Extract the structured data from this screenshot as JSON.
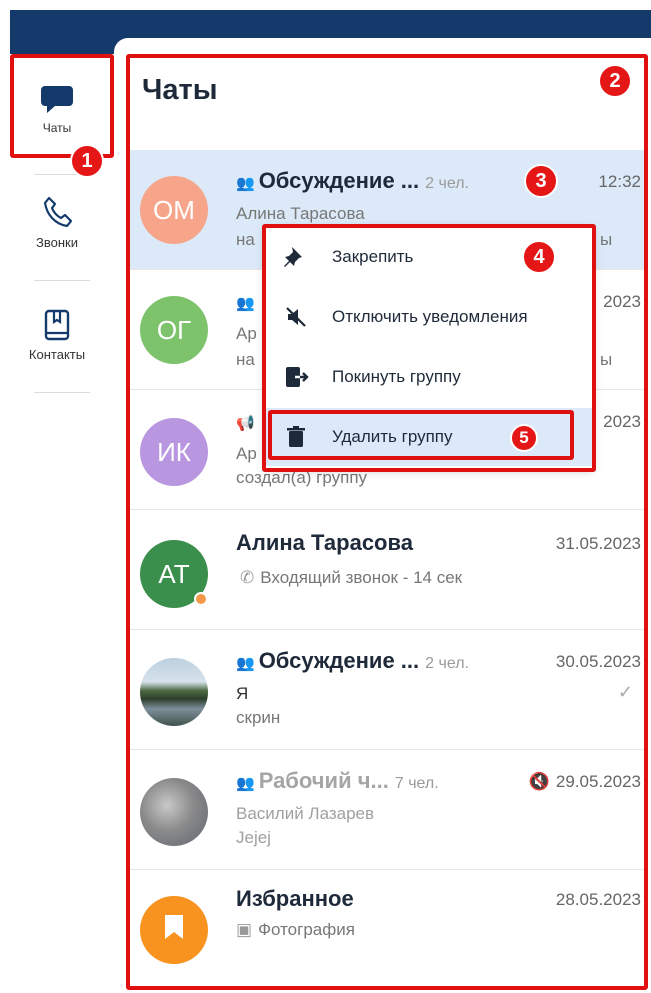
{
  "sidebar": {
    "items": [
      {
        "label": "Чаты",
        "icon": "chat-bubble-icon"
      },
      {
        "label": "Звонки",
        "icon": "phone-icon"
      },
      {
        "label": "Контакты",
        "icon": "contacts-book-icon"
      }
    ]
  },
  "header": {
    "title": "Чаты"
  },
  "chats": [
    {
      "initials": "ОМ",
      "avatar_color": "#f7a58a",
      "name": "Обсуждение ...",
      "members": "2 чел.",
      "time": "12:32",
      "line1": "Алина Тарасова",
      "line2": "на",
      "line2_tail": "ы"
    },
    {
      "initials": "ОГ",
      "avatar_color": "#7dc36b",
      "time": "2023",
      "line1": "Ар",
      "line2": "на",
      "line2_tail": "ы"
    },
    {
      "initials": "ИК",
      "avatar_color": "#b896e0",
      "time": "2023",
      "line1": "Ар",
      "line2": "создал(а) группу"
    },
    {
      "initials": "АТ",
      "avatar_color": "#3a8f4c",
      "name": "Алина Тарасова",
      "time": "31.05.2023",
      "line1": "Входящий звонок - 14 сек"
    },
    {
      "name": "Обсуждение ...",
      "members": "2 чел.",
      "time": "30.05.2023",
      "line1": "Я",
      "line2": "скрин"
    },
    {
      "name": "Рабочий ч...",
      "members": "7 чел.",
      "time": "29.05.2023",
      "line1": "Василий Лазарев",
      "line2": "Jejej"
    },
    {
      "name": "Избранное",
      "avatar_color": "#f7931e",
      "time": "28.05.2023",
      "line1": "Фотография"
    }
  ],
  "context_menu": {
    "items": [
      {
        "label": "Закрепить",
        "icon": "pin-icon"
      },
      {
        "label": "Отключить уведомления",
        "icon": "mute-icon"
      },
      {
        "label": "Покинуть группу",
        "icon": "leave-icon"
      },
      {
        "label": "Удалить группу",
        "icon": "trash-icon"
      }
    ]
  },
  "callouts": [
    "1",
    "2",
    "3",
    "4",
    "5"
  ],
  "colors": {
    "accent_red": "#e01010",
    "topbar": "#143a6b",
    "selected_row": "#dbe9f8"
  }
}
